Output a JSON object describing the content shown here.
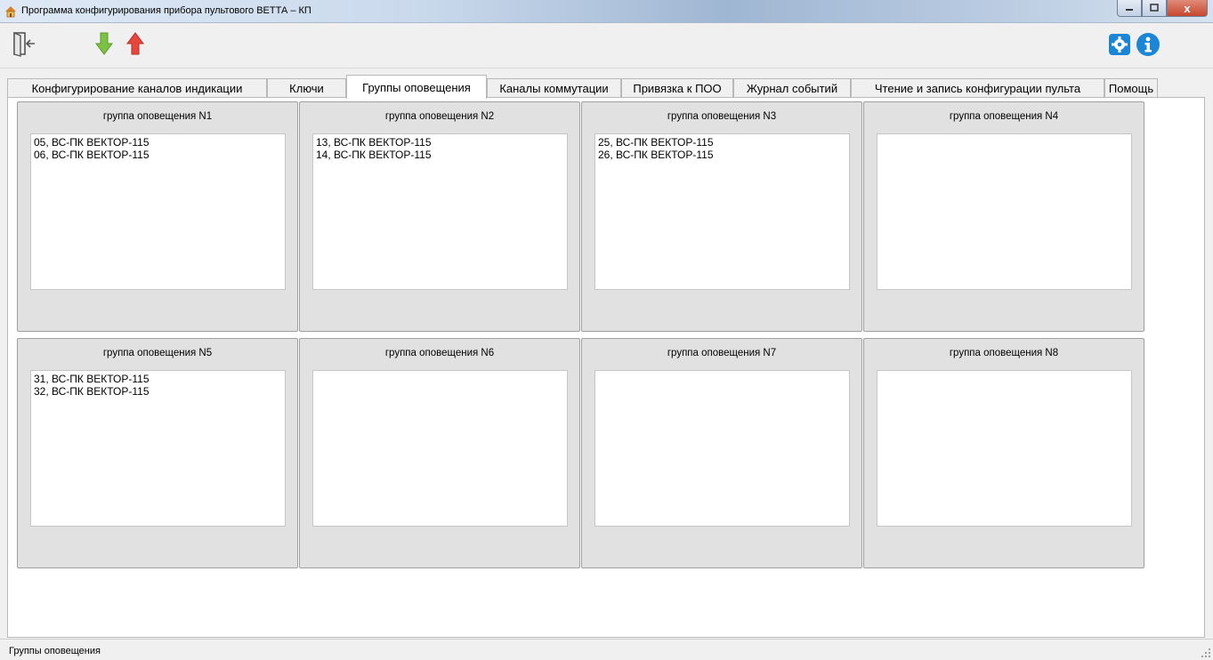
{
  "window": {
    "title": "Программа конфигурирования прибора пультового ВЕТТА – КП",
    "close_glyph": "x"
  },
  "toolbar": {
    "exit_icon": "exit-door-icon",
    "read_icon": "green-down-arrow-icon",
    "write_icon": "red-up-arrow-icon",
    "settings_icon": "gear-icon",
    "info_icon": "info-icon",
    "accent": "#1b86d6",
    "green": "#7cc242",
    "red": "#e8463a"
  },
  "tabs": [
    {
      "label": "Конфигурирование каналов индикации",
      "active": false
    },
    {
      "label": "Ключи",
      "active": false
    },
    {
      "label": "Группы оповещения",
      "active": true
    },
    {
      "label": "Каналы коммутации",
      "active": false
    },
    {
      "label": "Привязка к ПОО",
      "active": false
    },
    {
      "label": "Журнал событий",
      "active": false
    },
    {
      "label": "Чтение и запись конфигурации пульта",
      "active": false
    },
    {
      "label": "Помощь",
      "active": false
    }
  ],
  "groups": [
    {
      "title": "группа оповещения N1",
      "items": [
        "05, ВС-ПК ВЕКТОР-115",
        "06, ВС-ПК ВЕКТОР-115"
      ]
    },
    {
      "title": "группа оповещения N2",
      "items": [
        "13, ВС-ПК ВЕКТОР-115",
        "14, ВС-ПК ВЕКТОР-115"
      ]
    },
    {
      "title": "группа оповещения N3",
      "items": [
        "25, ВС-ПК ВЕКТОР-115",
        "26, ВС-ПК ВЕКТОР-115"
      ]
    },
    {
      "title": "группа оповещения N4",
      "items": []
    },
    {
      "title": "группа оповещения N5",
      "items": [
        "31, ВС-ПК ВЕКТОР-115",
        "32, ВС-ПК ВЕКТОР-115"
      ]
    },
    {
      "title": "группа оповещения N6",
      "items": []
    },
    {
      "title": "группа оповещения N7",
      "items": []
    },
    {
      "title": "группа оповещения N8",
      "items": []
    }
  ],
  "statusbar": {
    "text": "Группы оповещения"
  }
}
